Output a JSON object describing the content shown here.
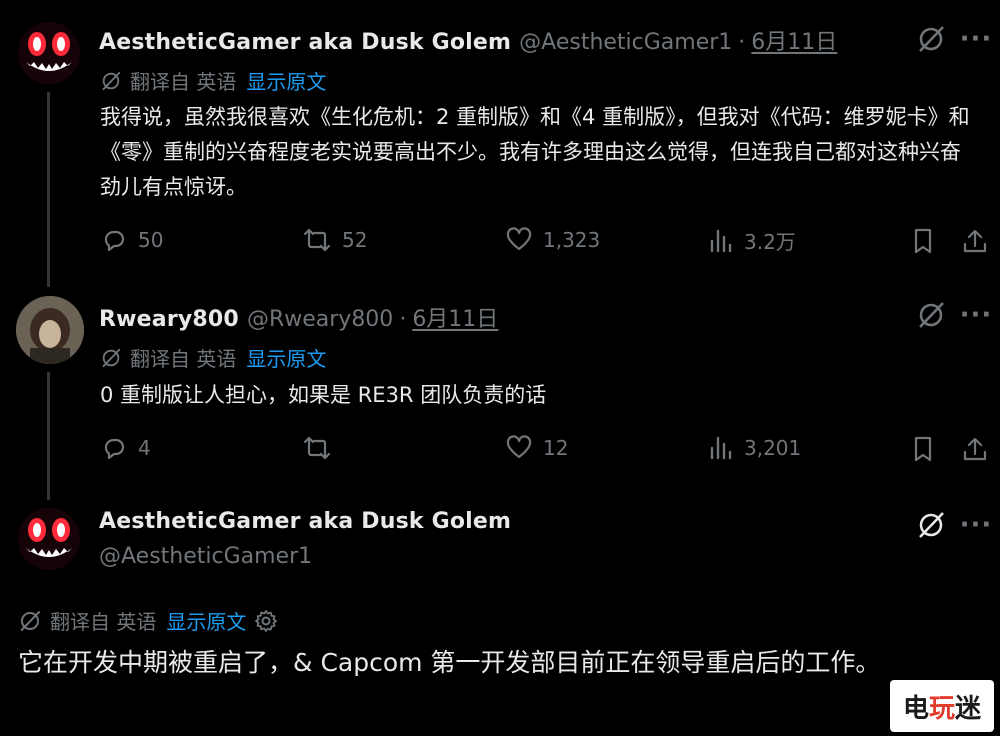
{
  "tweets": [
    {
      "display_name": "AestheticGamer aka Dusk Golem",
      "handle": "@AestheticGamer1",
      "dot": "·",
      "date": "6月11日",
      "translate_label": "翻译自 英语",
      "show_original": "显示原文",
      "text": "我得说，虽然我很喜欢《生化危机：2 重制版》和《4 重制版》，但我对《代码：维罗妮卡》和《零》重制的兴奋程度老实说要高出不少。我有许多理由这么觉得，但连我自己都对这种兴奋劲儿有点惊讶。",
      "replies": "50",
      "retweets": "52",
      "likes": "1,323",
      "views": "3.2万"
    },
    {
      "display_name": "Rweary800",
      "handle": "@Rweary800",
      "dot": "·",
      "date": "6月11日",
      "translate_label": "翻译自 英语",
      "show_original": "显示原文",
      "text": "0 重制版让人担心，如果是 RE3R 团队负责的话",
      "replies": "4",
      "retweets": "",
      "likes": "12",
      "views": "3,201"
    },
    {
      "display_name": "AestheticGamer aka Dusk Golem",
      "handle": "@AestheticGamer1",
      "translate_label": "翻译自 英语",
      "show_original": "显示原文",
      "text": "它在开发中期被重启了，& Capcom 第一开发部目前正在领导重启后的工作。"
    }
  ],
  "more_glyph": "···",
  "watermark": {
    "left": "电",
    "mid": "玩",
    "right": "迷"
  },
  "colors": {
    "background": "#000000",
    "text": "#e7e9ea",
    "muted": "#71767b",
    "link": "#1d9bf0"
  },
  "icons": [
    "reply-icon",
    "retweet-icon",
    "like-icon",
    "views-icon",
    "bookmark-icon",
    "share-icon",
    "grok-icon",
    "translate-icon",
    "gear-icon"
  ]
}
